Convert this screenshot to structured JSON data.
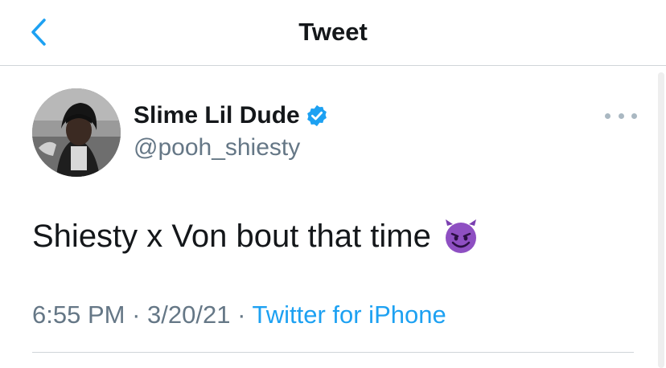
{
  "nav": {
    "title": "Tweet",
    "back_icon": "chevron-left-icon",
    "accent_color": "#1da1f2"
  },
  "tweet": {
    "author": {
      "display_name": "Slime Lil Dude",
      "handle": "@pooh_shiesty",
      "verified": true,
      "verified_icon": "verified-badge-icon",
      "avatar": "profile-photo"
    },
    "text": "Shiesty x Von bout that time",
    "emoji": "smiling-devil-emoji",
    "time": "6:55 PM",
    "separator": "·",
    "date": "3/20/21",
    "source": "Twitter for iPhone",
    "more_icon": "more-options-icon"
  },
  "colors": {
    "primary_text": "#14171a",
    "secondary_text": "#657786",
    "link": "#1da1f2",
    "divider": "#d0d5d9",
    "emoji_purple": "#8e4fc2"
  }
}
